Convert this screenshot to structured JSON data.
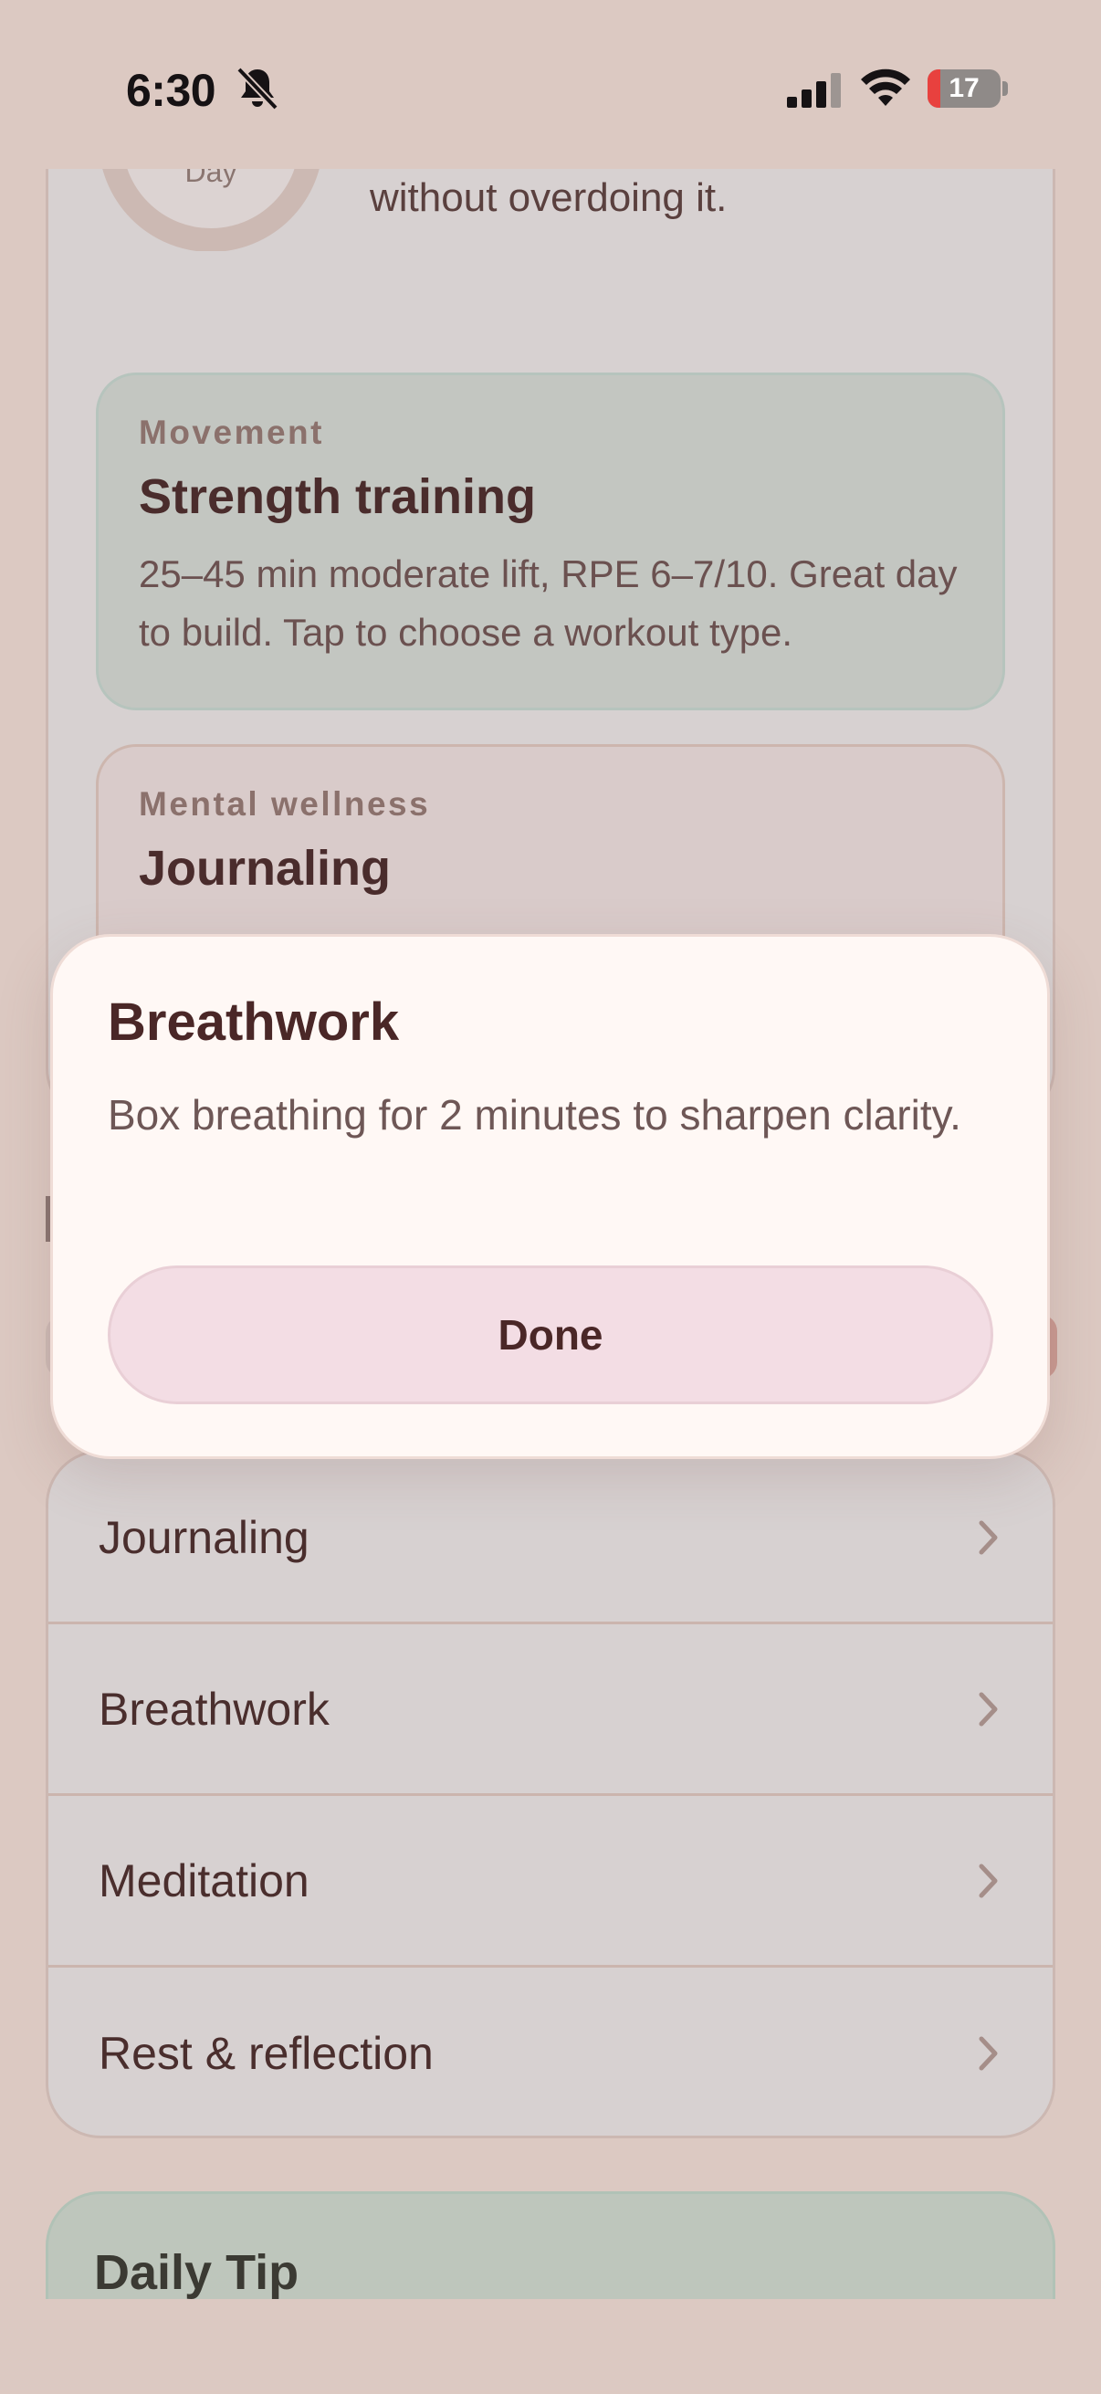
{
  "status_bar": {
    "time": "6:30",
    "battery": "17",
    "battery_level_percent": 17,
    "icons": [
      "bell-slash-icon",
      "cellular-signal-icon",
      "wifi-icon",
      "battery-icon"
    ]
  },
  "phase_card": {
    "ring_label": "Day",
    "description": "Energy is rising. Build momentum without overdoing it."
  },
  "recommendations": [
    {
      "category": "Movement",
      "title": "Strength training",
      "description": "25–45 min moderate lift, RPE 6–7/10. Great day to build. Tap to choose a workout type."
    },
    {
      "category": "Mental wellness",
      "title": "Journaling"
    }
  ],
  "practice_list": {
    "items": [
      {
        "label": "Journaling"
      },
      {
        "label": "Breathwork"
      },
      {
        "label": "Meditation"
      },
      {
        "label": "Rest & reflection"
      }
    ]
  },
  "daily_tip": {
    "title": "Daily Tip"
  },
  "modal": {
    "title": "Breathwork",
    "body": "Box breathing for 2 minutes to sharpen clarity.",
    "done_label": "Done"
  },
  "colors": {
    "background": "#dcc9c2",
    "movement_card": "#c3c6c1",
    "mental_card": "#d9cbca",
    "modal": "#fff8f5",
    "done_button": "#f3dde4",
    "battery_low": "#e8413e"
  }
}
